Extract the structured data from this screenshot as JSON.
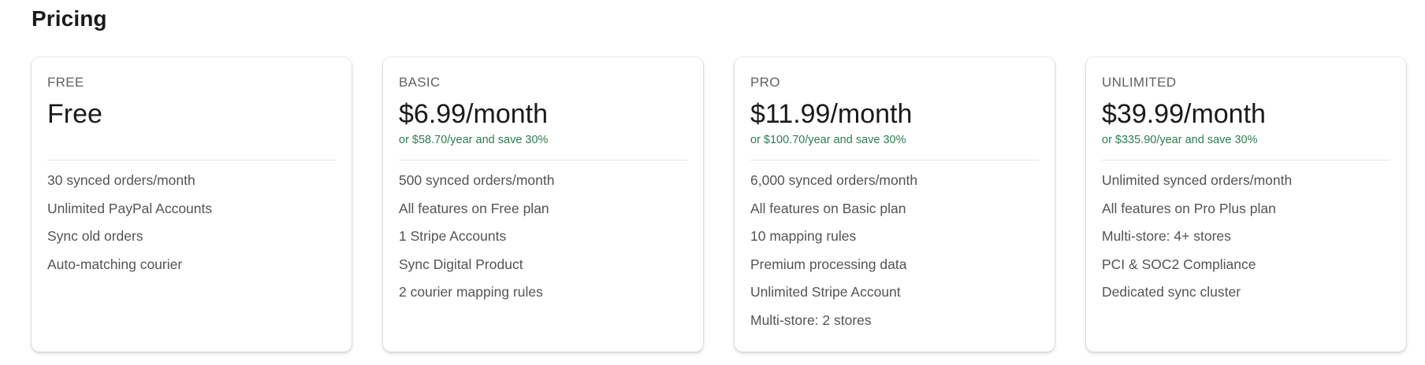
{
  "page": {
    "title": "Pricing"
  },
  "colors": {
    "yearly_text": "#2e7d4f",
    "card_bg": "#ffffff",
    "feature_text": "#545454"
  },
  "plans": [
    {
      "tier": "FREE",
      "price": "Free",
      "yearly": "",
      "features": [
        "30 synced orders/month",
        "Unlimited PayPal Accounts",
        "Sync old orders",
        "Auto-matching courier"
      ]
    },
    {
      "tier": "BASIC",
      "price": "$6.99/month",
      "yearly": "or $58.70/year and save 30%",
      "features": [
        "500 synced orders/month",
        "All features on Free plan",
        "1 Stripe Accounts",
        "Sync Digital Product",
        "2 courier mapping rules"
      ]
    },
    {
      "tier": "PRO",
      "price": "$11.99/month",
      "yearly": "or $100.70/year and save 30%",
      "features": [
        "6,000 synced orders/month",
        "All features on Basic plan",
        "10 mapping rules",
        "Premium processing data",
        "Unlimited Stripe Account",
        "Multi-store: 2 stores"
      ]
    },
    {
      "tier": "UNLIMITED",
      "price": "$39.99/month",
      "yearly": "or $335.90/year and save 30%",
      "features": [
        "Unlimited synced orders/month",
        "All features on Pro Plus plan",
        "Multi-store: 4+ stores",
        "PCI & SOC2 Compliance",
        "Dedicated sync cluster"
      ]
    }
  ]
}
